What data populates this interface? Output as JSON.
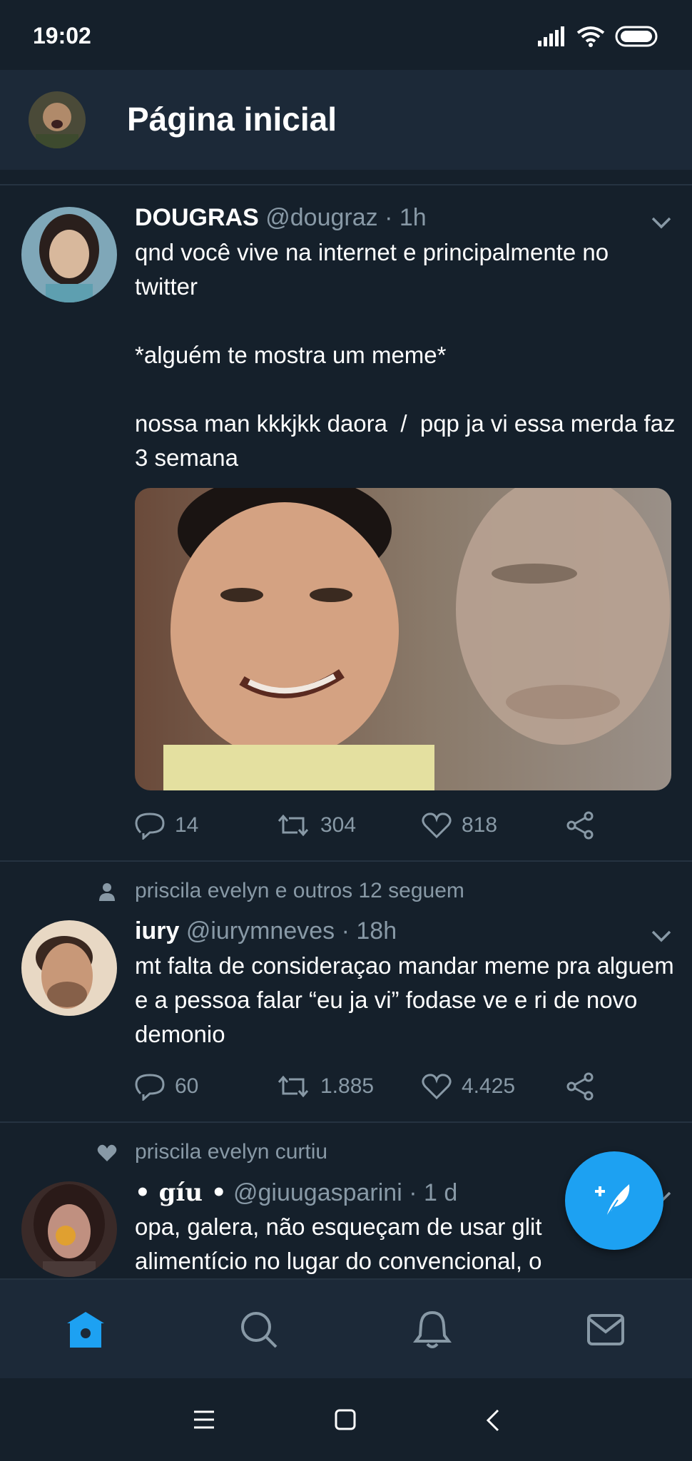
{
  "status_bar": {
    "time": "19:02"
  },
  "header": {
    "title": "Página inicial"
  },
  "tweets": [
    {
      "name": "DOUGRAS",
      "handle": "@dougraz",
      "time": "· 1h",
      "text": "qnd você vive na internet e principalmente no twitter\n\n*alguém te mostra um meme*\n\nnossa man kkkjkk daora  /  pqp ja vi essa merda faz 3 semana",
      "replies": "14",
      "retweets": "304",
      "likes": "818"
    },
    {
      "context": "priscila evelyn e outros 12 seguem",
      "name": "iury",
      "handle": "@iurymneves",
      "time": "· 18h",
      "text": "mt falta de consideraçao mandar meme pra alguem e a pessoa falar “eu ja vi” fodase ve e ri de novo demonio",
      "replies": "60",
      "retweets": "1.885",
      "likes": "4.425"
    },
    {
      "context": "priscila evelyn curtiu",
      "name": "• gíu •",
      "handle": "@giuugasparini",
      "time": "· 1 d",
      "text": "opa, galera, não esqueçam de usar glit\nalimentício no lugar do convencional, o"
    }
  ],
  "colors": {
    "background": "#15202b",
    "header": "#1c2938",
    "accent": "#1da1f2",
    "muted": "#8899a6"
  },
  "icons": [
    "signal-icon",
    "wifi-icon",
    "battery-icon",
    "reply-icon",
    "retweet-icon",
    "like-icon",
    "share-icon",
    "home-icon",
    "search-icon",
    "bell-icon",
    "mail-icon",
    "compose-icon"
  ]
}
